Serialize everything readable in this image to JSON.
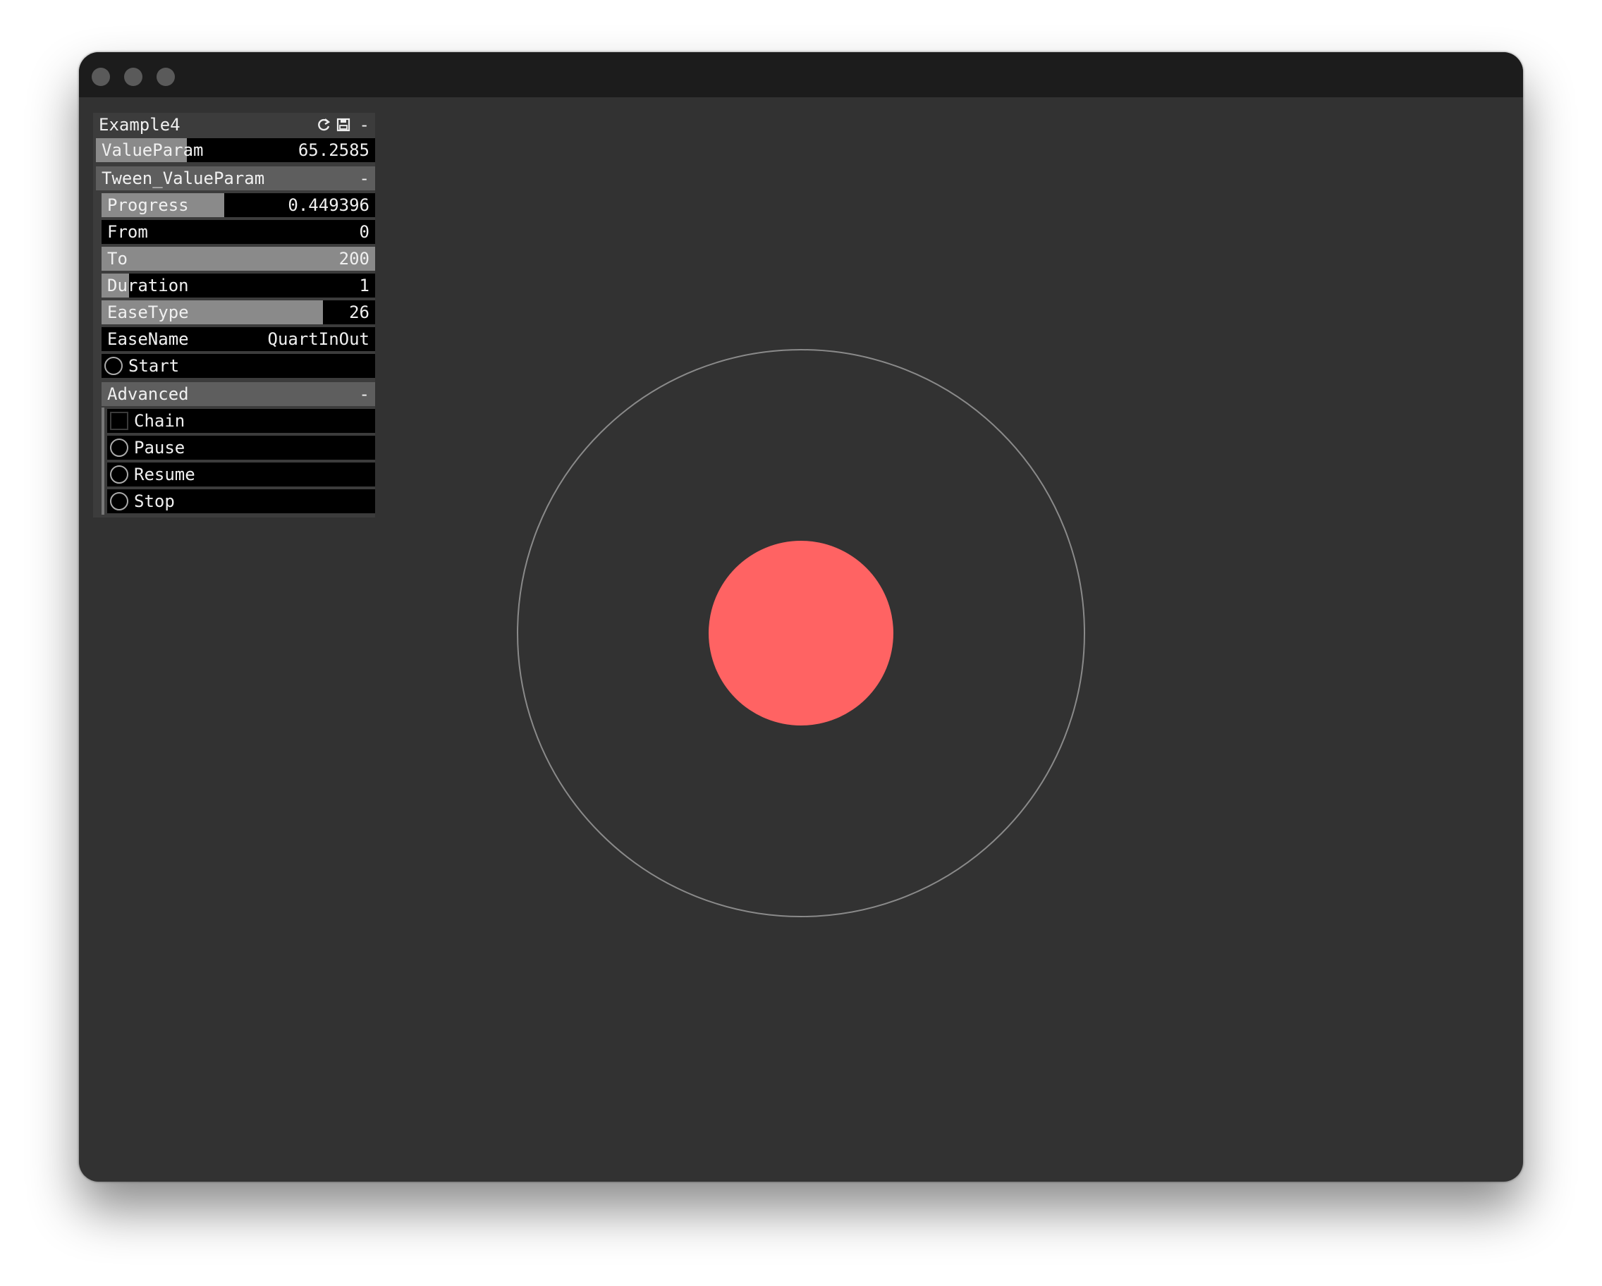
{
  "panel": {
    "title": "Example4",
    "minimize": "-",
    "icons": [
      "refresh-icon",
      "save-icon"
    ],
    "value_param": {
      "label": "ValueParam",
      "value": "65.2585",
      "fill_fraction": 0.326
    },
    "tween_group": {
      "label": "Tween_ValueParam",
      "minimize": "-",
      "progress": {
        "label": "Progress",
        "value": "0.449396",
        "fill_fraction": 0.449
      },
      "from": {
        "label": "From",
        "value": "0",
        "fill_fraction": 0.0
      },
      "to": {
        "label": "To",
        "value": "200",
        "fill_fraction": 1.0
      },
      "duration": {
        "label": "Duration",
        "value": "1",
        "fill_fraction": 0.1
      },
      "ease_type": {
        "label": "EaseType",
        "value": "26",
        "fill_fraction": 0.81
      },
      "ease_name": {
        "label": "EaseName",
        "value": "QuartInOut"
      },
      "start": {
        "label": "Start"
      }
    },
    "advanced_group": {
      "label": "Advanced",
      "minimize": "-",
      "chain": {
        "label": "Chain"
      },
      "pause": {
        "label": "Pause"
      },
      "resume": {
        "label": "Resume"
      },
      "stop": {
        "label": "Stop"
      }
    }
  },
  "scene": {
    "background": "#323232",
    "outer_circle_color": "#8a8a8a",
    "inner_circle_color": "#ff6363"
  }
}
